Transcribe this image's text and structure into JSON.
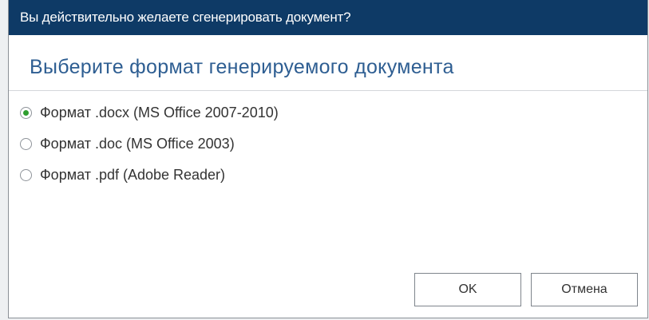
{
  "dialog": {
    "title": "Вы действительно желаете сгенерировать документ?",
    "heading": "Выберите формат генерируемого документа",
    "options": [
      {
        "label": "Формат .docx (MS Office 2007-2010)",
        "selected": true
      },
      {
        "label": "Формат .doc (MS Office 2003)",
        "selected": false
      },
      {
        "label": "Формат .pdf (Adobe Reader)",
        "selected": false
      }
    ],
    "ok_label": "OK",
    "cancel_label": "Отмена"
  },
  "colors": {
    "titlebar": "#0e3a66",
    "heading": "#2e5e92",
    "radio_selected": "#2f9e2f"
  }
}
